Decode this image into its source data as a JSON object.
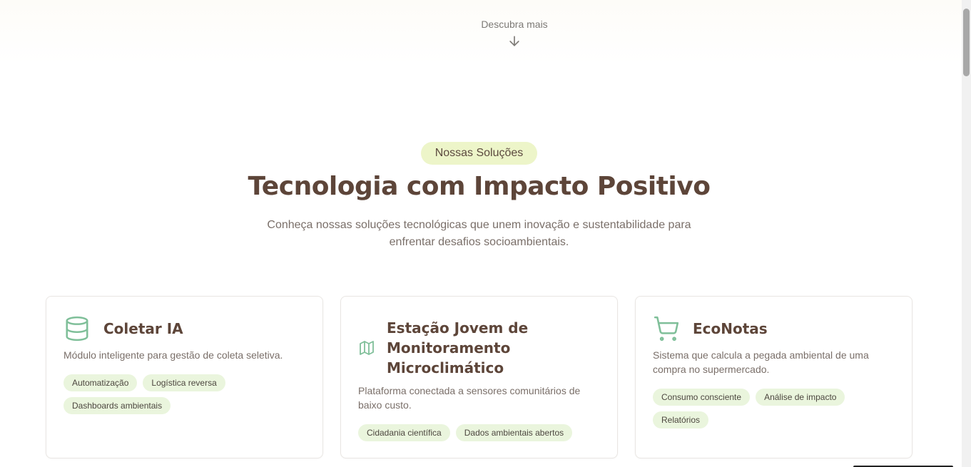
{
  "hero": {
    "discover_label": "Descubra mais",
    "discover_icon": "arrow-down-icon"
  },
  "section": {
    "badge": "Nossas Soluções",
    "title": "Tecnologia com Impacto Positivo",
    "subtitle_line1": "Conheça nossas soluções tecnológicas que unem inovação e sustentabilidade para",
    "subtitle_line2": "enfrentar desafios socioambientais."
  },
  "cards": [
    {
      "icon": "database-icon",
      "title": "Coletar IA",
      "description": "Módulo inteligente para gestão de coleta seletiva.",
      "tags": [
        "Automatização",
        "Logística reversa",
        "Dashboards ambientais"
      ]
    },
    {
      "icon": "map-icon",
      "title_line1": "Estação Jovem de",
      "title_line2": "Monitoramento",
      "title_line3": "Microclimático",
      "description": "Plataforma conectada a sensores comunitários de baixo custo.",
      "tags": [
        "Cidadania científica",
        "Dados ambientais abertos"
      ]
    },
    {
      "icon": "shopping-cart-icon",
      "title": "EcoNotas",
      "description": "Sistema que calcula a pegada ambiental de uma compra no supermercado.",
      "tags": [
        "Consumo consciente",
        "Análise de impacto",
        "Relatórios"
      ]
    }
  ],
  "colors": {
    "accent_green": "#7fbf99",
    "badge_bg": "#edf5c9",
    "tag_bg": "#eaf5dd",
    "heading": "#5d4539"
  }
}
